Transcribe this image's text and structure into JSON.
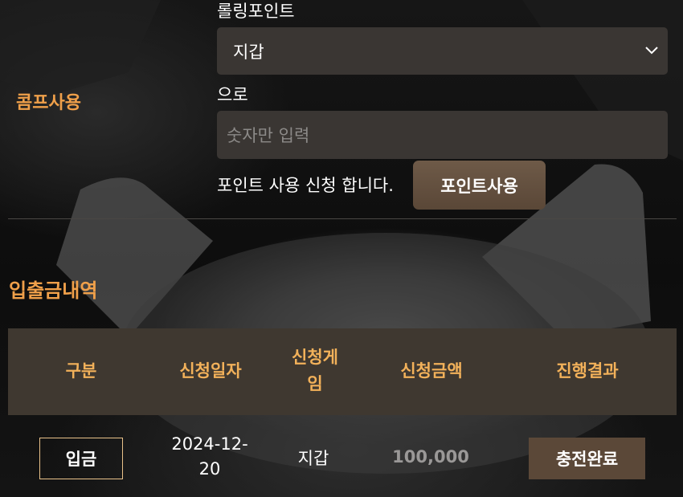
{
  "comp_section": {
    "label": "콤프사용",
    "rolling_label": "롤링포인트",
    "select": {
      "selected": "지갑"
    },
    "to_label": "으로",
    "amount_input": {
      "placeholder": "숫자만 입력",
      "value": ""
    },
    "apply_text": "포인트 사용 신청 합니다.",
    "apply_button": "포인트사용"
  },
  "history": {
    "title": "입출금내역",
    "columns": [
      "구분",
      "신청일자",
      "신청게임",
      "신청금액",
      "진행결과"
    ],
    "rows": [
      {
        "type": "입금",
        "date": "2024-12-20",
        "game": "지갑",
        "amount": "100,000",
        "result": "충전완료"
      }
    ]
  },
  "colors": {
    "accent": "#f0a04a",
    "header_text": "#f2b15a",
    "input_bg": "#3a3633",
    "button_bg": "#6e5a48",
    "table_header_bg": "#3f3830"
  },
  "icons": {
    "select_arrow": "chevron-down-icon"
  }
}
